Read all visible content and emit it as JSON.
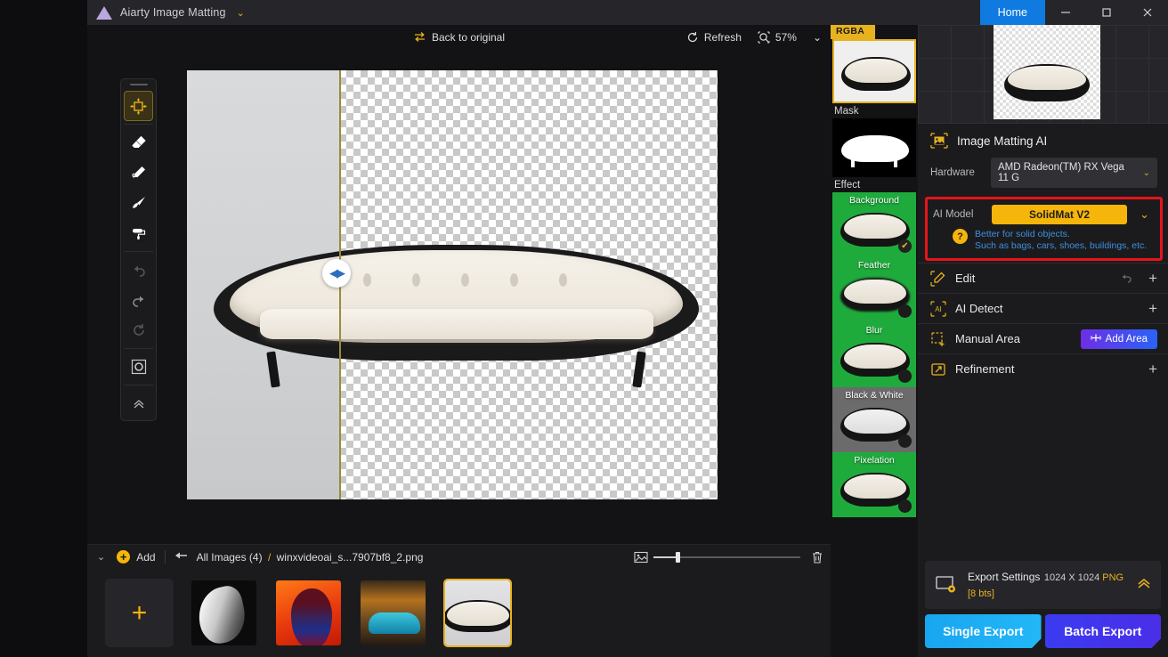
{
  "titlebar": {
    "app_name": "Aiarty Image Matting",
    "dropdown_icon": "chevron-down-icon",
    "home_label": "Home",
    "minimize": "–",
    "maximize": "▢",
    "close": "✕"
  },
  "canvas_toolbar": {
    "back_to_original": "Back to original",
    "back_icon": "swap-arrows-icon",
    "refresh": "Refresh",
    "refresh_icon": "refresh-icon",
    "zoom_icon": "zoom-icon",
    "zoom_level": "57%",
    "zoom_chevron": "chevron-down-icon"
  },
  "tools": [
    {
      "name": "move-tool",
      "glyph": "✥",
      "active": true,
      "dim": false
    },
    {
      "name": "eraser-tool",
      "glyph": "◤",
      "active": false,
      "dim": false
    },
    {
      "name": "pencil-tool",
      "glyph": "✎",
      "active": false,
      "dim": false
    },
    {
      "name": "brush-tool",
      "glyph": "🖌",
      "active": false,
      "dim": false
    },
    {
      "name": "roller-tool",
      "glyph": "▤",
      "active": false,
      "dim": false
    },
    {
      "name": "undo-tool",
      "glyph": "↩",
      "active": false,
      "dim": true
    },
    {
      "name": "redo-tool",
      "glyph": "↪",
      "active": false,
      "dim": false
    },
    {
      "name": "reset-tool",
      "glyph": "↺",
      "active": false,
      "dim": true
    },
    {
      "name": "mask-preview-tool",
      "glyph": "◉",
      "active": false,
      "dim": false
    },
    {
      "name": "collapse-rail",
      "glyph": "⌃",
      "active": false,
      "dim": false
    }
  ],
  "effects_strip": {
    "rgba_tab": "RGBA",
    "mask_label": "Mask",
    "effect_label": "Effect",
    "items": [
      {
        "label": "Background",
        "bg": "#1eab3c",
        "selected": true
      },
      {
        "label": "Feather",
        "bg": "#1eab3c",
        "selected": false
      },
      {
        "label": "Blur",
        "bg": "#1eab3c",
        "selected": false
      },
      {
        "label": "Black & White",
        "bg": "#6b6b6b",
        "selected": false
      },
      {
        "label": "Pixelation",
        "bg": "#1eab3c",
        "selected": false
      }
    ]
  },
  "right_panel": {
    "section_title": "Image Matting AI",
    "section_icon": "image-matting-icon",
    "hardware_label": "Hardware",
    "hardware_value": "AMD Radeon(TM) RX Vega 11 G",
    "ai_model_label": "AI Model",
    "ai_model_value": "SolidMat  V2",
    "hint_line1": "Better for solid objects.",
    "hint_line2": "Such as bags, cars, shoes, buildings, etc.",
    "help_glyph": "?",
    "highlight_color": "#e8131b",
    "options": [
      {
        "name": "edit",
        "label": "Edit",
        "icon": "edit-icon",
        "has_undo": true,
        "action": "plus",
        "action_label": "+"
      },
      {
        "name": "ai-detect",
        "label": "AI Detect",
        "icon": "ai-detect-icon",
        "has_undo": false,
        "action": "plus",
        "action_label": "+"
      },
      {
        "name": "manual-area",
        "label": "Manual Area",
        "icon": "manual-area-icon",
        "has_undo": false,
        "action": "button",
        "action_label": "Add Area"
      },
      {
        "name": "refinement",
        "label": "Refinement",
        "icon": "refinement-icon",
        "has_undo": false,
        "action": "plus",
        "action_label": "+"
      }
    ],
    "export": {
      "title": "Export Settings",
      "dimensions": "1024 X 1024",
      "format": "PNG",
      "bits": "[8 bts]",
      "collapse_icon": "chevron-up-icon",
      "single_export": "Single Export",
      "batch_export": "Batch Export"
    }
  },
  "filmstrip": {
    "collapse_icon": "chevron-down-icon",
    "add_label": "Add",
    "back_icon": "arrow-left-icon",
    "all_images": "All Images (4)",
    "separator": "/",
    "current_file": "winxvideoai_s...7907bf8_2.png",
    "thumb_size_icon": "image-size-icon",
    "delete_icon": "trash-icon",
    "thumbnails": [
      {
        "name": "add-image",
        "kind": "add",
        "glyph": "+",
        "selected": false
      },
      {
        "name": "thumb-fabric",
        "kind": "fabric",
        "selected": false
      },
      {
        "name": "thumb-portrait",
        "kind": "portrait",
        "selected": false
      },
      {
        "name": "thumb-car",
        "kind": "car",
        "selected": false
      },
      {
        "name": "thumb-sofa",
        "kind": "sofa",
        "selected": true
      }
    ]
  }
}
